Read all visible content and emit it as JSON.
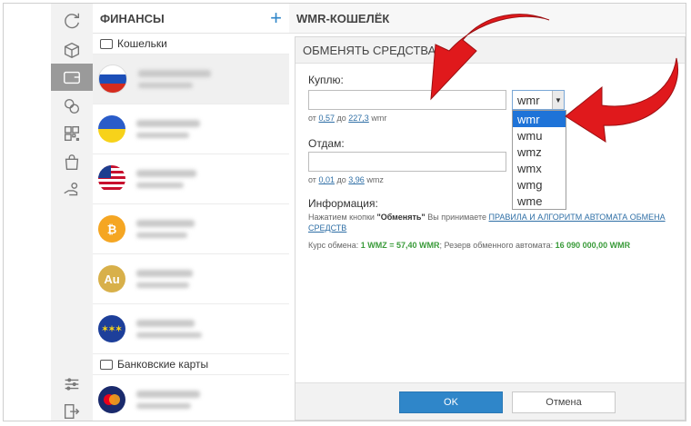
{
  "wallets_panel": {
    "title": "ФИНАНСЫ",
    "add_icon": "plus-icon",
    "section_wallets": "Кошельки",
    "section_cards": "Банковские карты",
    "flag_labels": [
      "",
      "",
      "",
      "",
      "Au",
      "",
      ""
    ]
  },
  "rail_icons": [
    "refresh-icon",
    "box-icon",
    "wallet-icon",
    "coins-icon",
    "qr-icon",
    "shopping-bag-icon",
    "hand-coin-icon",
    "settings-sliders-icon",
    "logout-icon"
  ],
  "main": {
    "title": "WMR-КОШЕЛЁК",
    "dialog": {
      "title": "ОБМЕНЯТЬ СРЕДСТВА",
      "buy_label": "Куплю:",
      "buy_range_from": "от",
      "buy_min": "0,57",
      "buy_range_to": "до",
      "buy_max": "227,3",
      "buy_unit": "wmr",
      "give_label": "Отдам:",
      "give_min": "0,01",
      "give_max": "3,96",
      "give_unit": "wmz",
      "select_value": "wmr",
      "select_options": [
        "wmr",
        "wmu",
        "wmz",
        "wmx",
        "wmg",
        "wme"
      ],
      "info_title": "Информация:",
      "info_prefix": "Нажатием кнопки ",
      "info_button_name": "\"Обменять\"",
      "info_middle": " Вы принимаете ",
      "info_link": "ПРАВИЛА И АЛГОРИТМ АВТОМАТА ОБМЕНА СРЕДСТВ",
      "rate_label": "Курс обмена: ",
      "rate_value": "1 WMZ = 57,40 WMR",
      "reserve_label": "; Резерв обменного автомата: ",
      "reserve_value": "16 090 000,00 WMR",
      "ok_label": "OK",
      "cancel_label": "Отмена"
    }
  },
  "colors": {
    "accent": "#2f86c9",
    "selected_option": "#1e73d8",
    "rate_green": "#3a9b3a",
    "arrow_red": "#e0191c"
  }
}
